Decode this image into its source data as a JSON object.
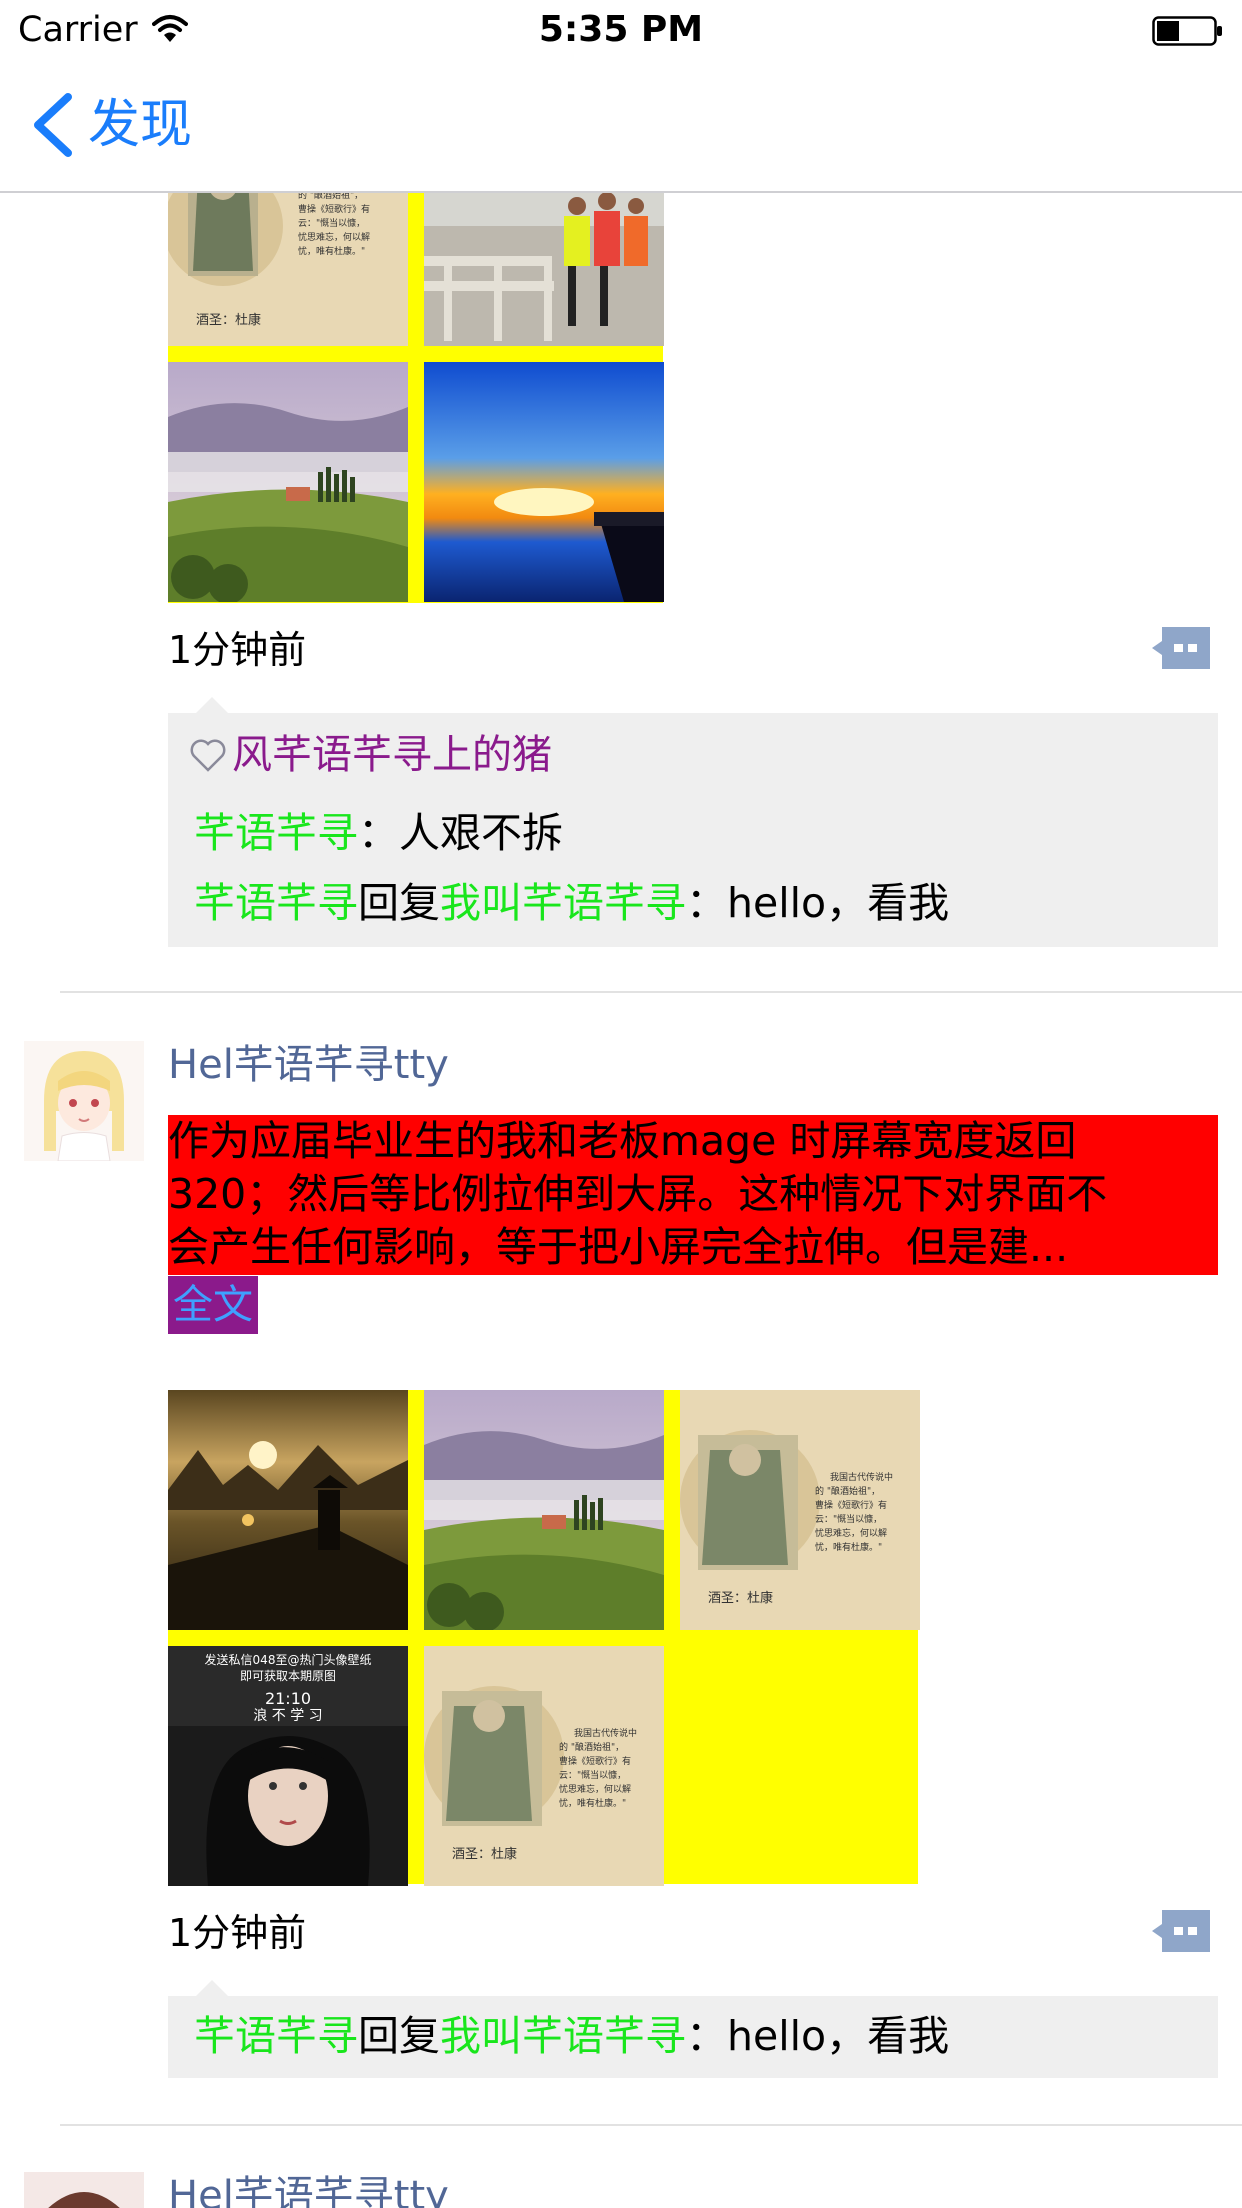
{
  "status_bar": {
    "carrier": "Carrier",
    "time": "5:35 PM"
  },
  "nav": {
    "back_label": "发现"
  },
  "colors": {
    "accent": "#1a7dfb",
    "username": "#516796",
    "reply_name": "#19e61c",
    "like_name": "#8a1a8c",
    "post_highlight": "#ff0000",
    "image_grid_bg": "#ffff00"
  },
  "post1": {
    "time": "1分钟前",
    "likes": "风芊语芊寻上的猪",
    "comments": [
      {
        "from": "芊语芊寻",
        "sep": "：",
        "text": "人艰不拆"
      },
      {
        "from": "芊语芊寻",
        "reply_word": "回复",
        "to": "我叫芊语芊寻",
        "sep": "：",
        "text": "hello，看我"
      }
    ],
    "images": [
      "drunk-sage-painting",
      "marathon-runners",
      "misty-valley-landscape",
      "sunset-lake"
    ]
  },
  "post2": {
    "username": "Hel芊语芊寻tty",
    "text_lines": [
      "作为应届毕业生的我和老板mage 时屏幕宽度返回",
      "320；然后等比例拉伸到大屏。这种情况下对界面不",
      "会产生任何影响，等于把小屏完全拉伸。但是建..."
    ],
    "fulltext_label": "全文",
    "time": "1分钟前",
    "comments": [
      {
        "from": "芊语芊寻",
        "reply_word": "回复",
        "to": "我叫芊语芊寻",
        "sep": "：",
        "text": "hello，看我"
      }
    ],
    "images": [
      "fisherman-sunset",
      "misty-valley-landscape",
      "drunk-sage-painting",
      "woman-portrait",
      "drunk-sage-painting"
    ]
  },
  "post3": {
    "username": "Hel芊语芊寻tty"
  }
}
